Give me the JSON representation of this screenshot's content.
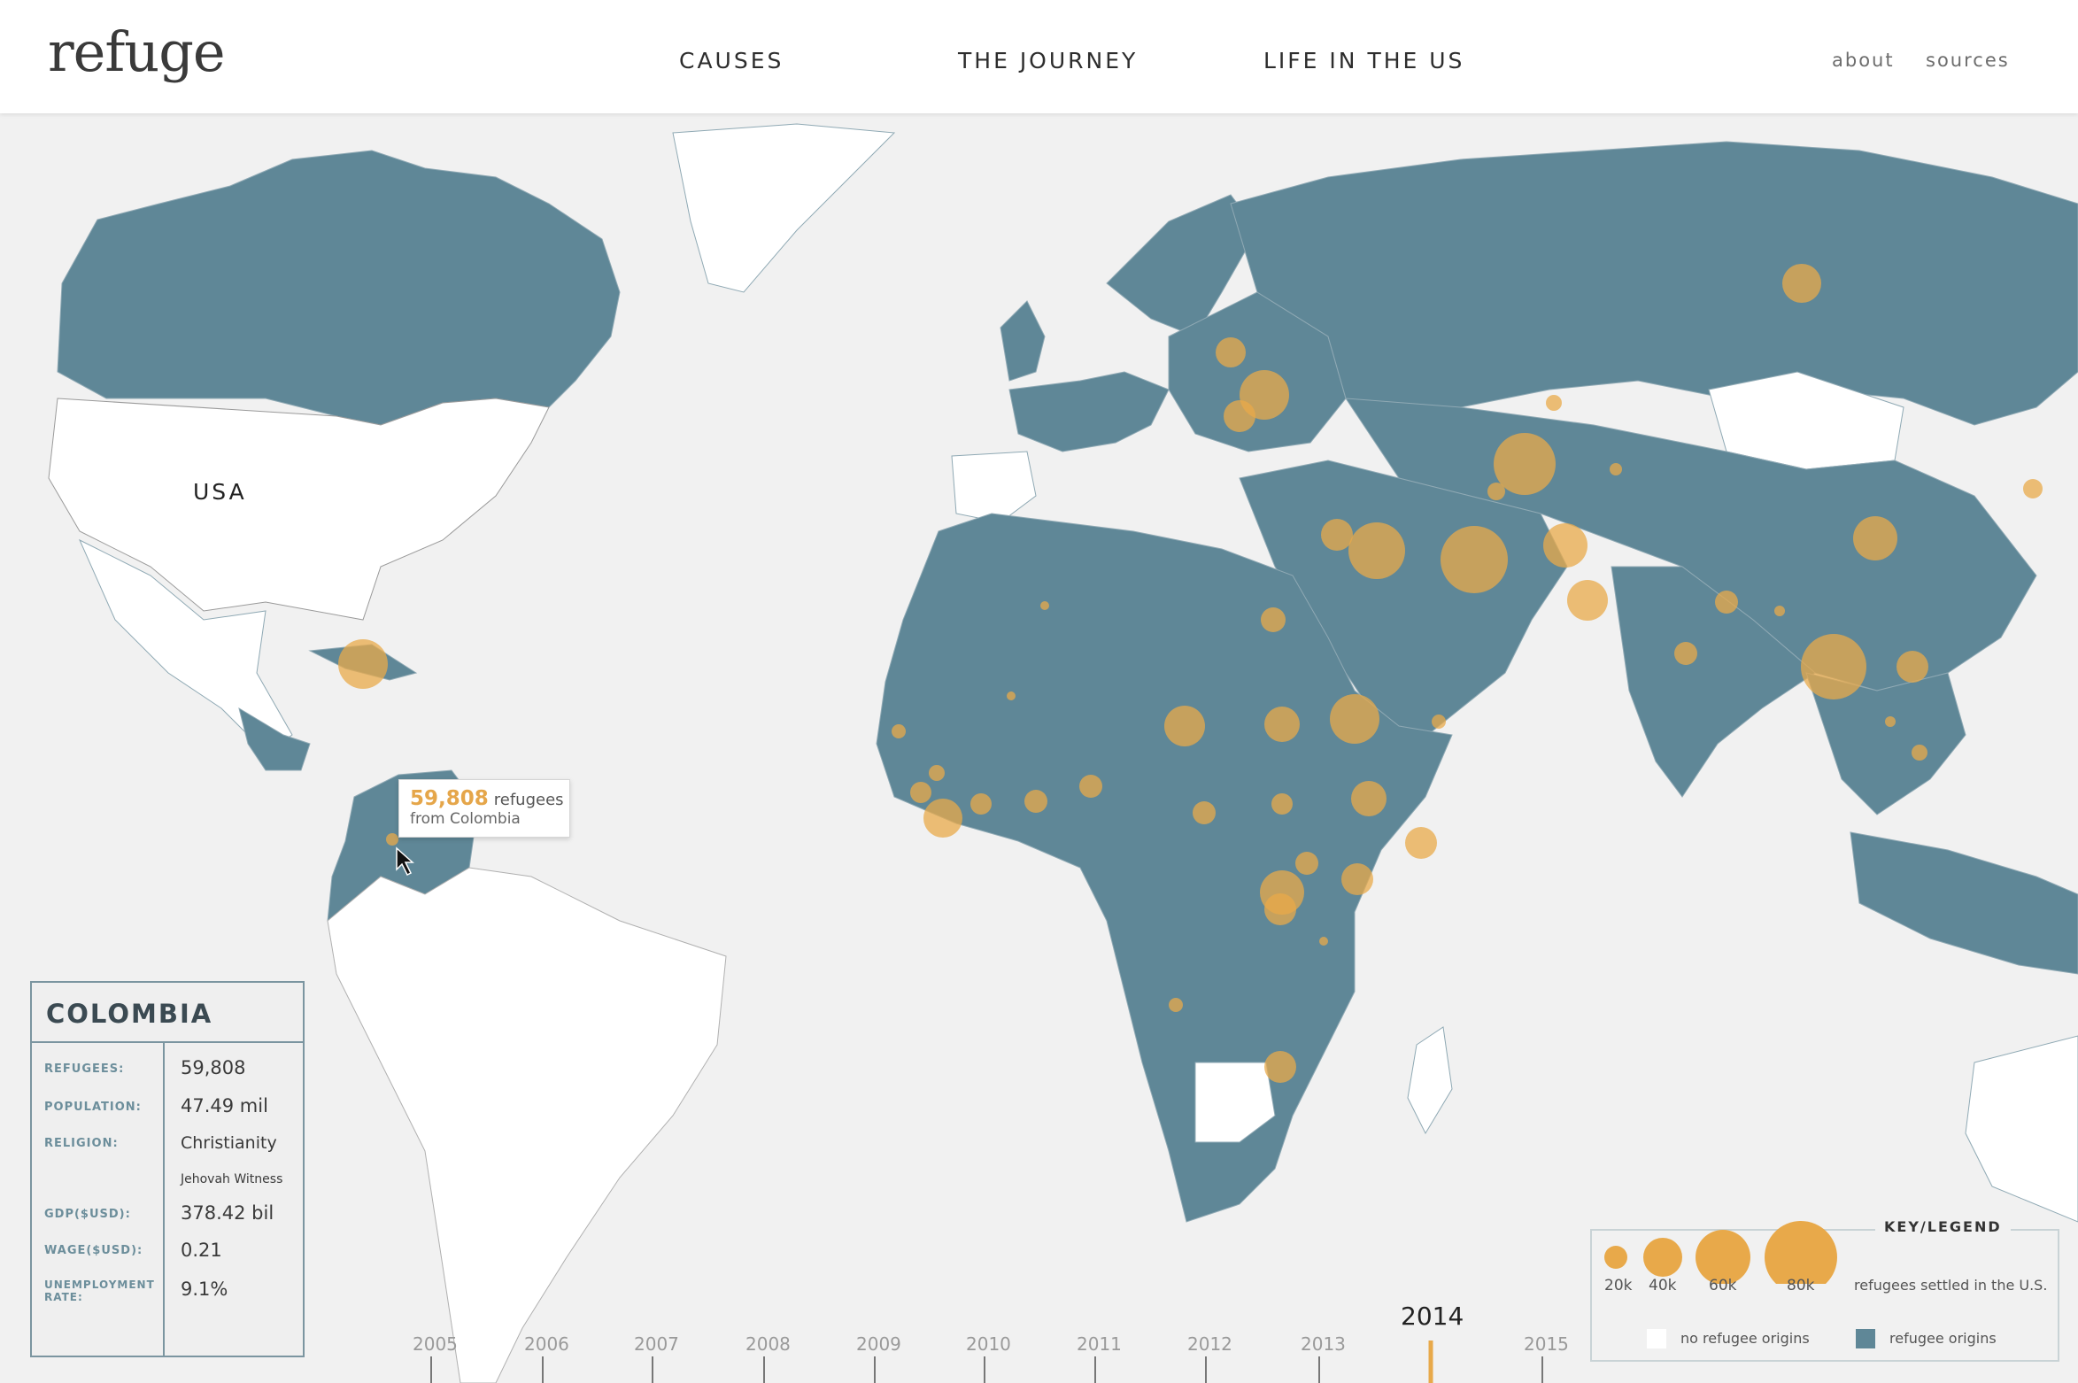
{
  "header": {
    "logo": "refuge",
    "nav": [
      "CAUSES",
      "THE JOURNEY",
      "LIFE IN THE US"
    ],
    "links": [
      "about",
      "sources"
    ]
  },
  "map": {
    "us_label": "USA",
    "colors": {
      "origin": "#5f8797",
      "none": "#ffffff",
      "ocean": "#f1f1f1",
      "bubble": "#e8a94a"
    }
  },
  "tooltip": {
    "count": "59,808",
    "unit": "refugees",
    "from": "from Colombia"
  },
  "info_panel": {
    "country": "COLOMBIA",
    "rows": [
      {
        "label": "REFUGEES:",
        "value": "59,808"
      },
      {
        "label": "POPULATION:",
        "value": "47.49 mil"
      },
      {
        "label": "RELIGION:",
        "value": "Christianity",
        "sub": "Jehovah Witness"
      },
      {
        "label": "GDP($USD):",
        "value": "378.42 bil"
      },
      {
        "label": "WAGE($USD):",
        "value": "0.21"
      },
      {
        "label": "UNEMPLOYMENT RATE:",
        "value": "9.1%"
      }
    ]
  },
  "legend": {
    "title": "KEY/LEGEND",
    "bubbles": [
      "20k",
      "40k",
      "60k",
      "80k"
    ],
    "bubble_caption": "refugees settled in the U.S.",
    "swatches": [
      {
        "label": "no refugee origins",
        "color": "#ffffff"
      },
      {
        "label": "refugee origins",
        "color": "#5f8797"
      }
    ]
  },
  "timeline": {
    "years": [
      "2005",
      "2006",
      "2007",
      "2008",
      "2009",
      "2010",
      "2011",
      "2012",
      "2013",
      "2014",
      "2015"
    ],
    "selected": "2014"
  }
}
